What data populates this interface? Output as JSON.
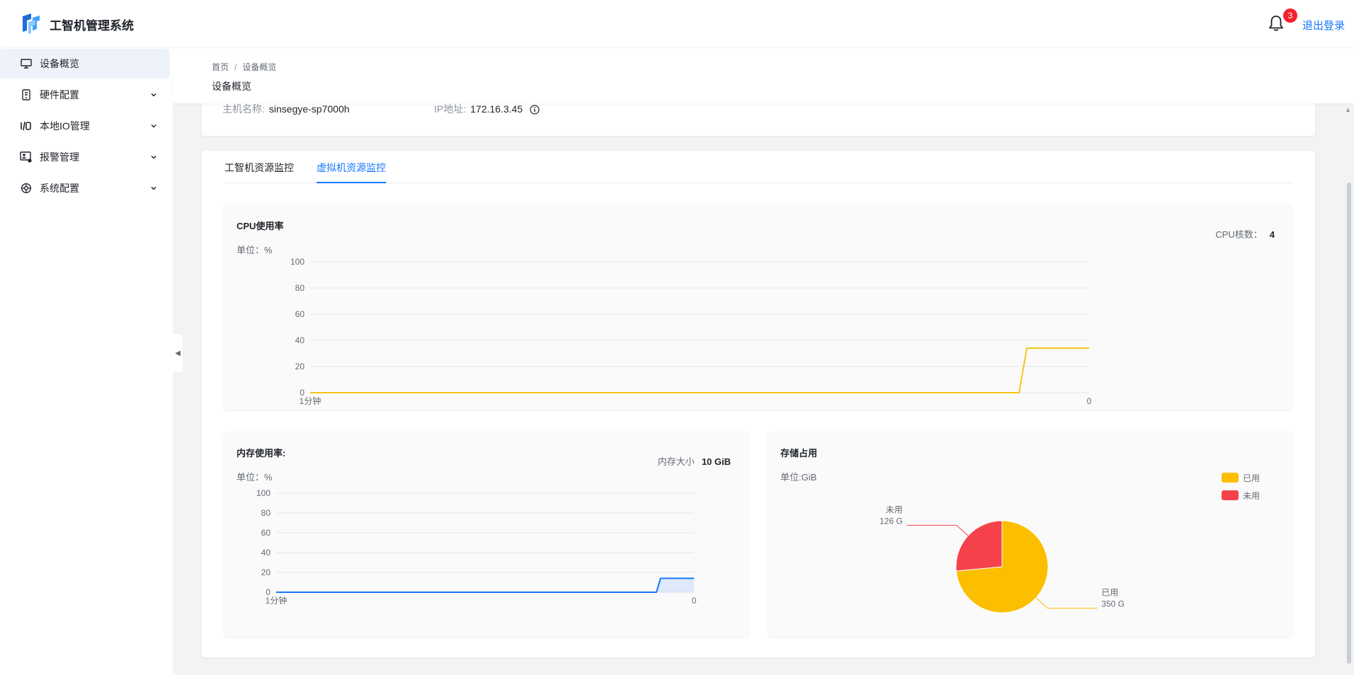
{
  "app": {
    "title": "工智机管理系统"
  },
  "header": {
    "notification_count": "3",
    "logout_label": "退出登录"
  },
  "sidebar": {
    "items": [
      {
        "label": "设备概览",
        "icon": "monitor-icon",
        "active": true,
        "expandable": false
      },
      {
        "label": "硬件配置",
        "icon": "hardware-icon",
        "active": false,
        "expandable": true
      },
      {
        "label": "本地IO管理",
        "icon": "io-icon",
        "active": false,
        "expandable": true
      },
      {
        "label": "报警管理",
        "icon": "alarm-icon",
        "active": false,
        "expandable": true
      },
      {
        "label": "系统配置",
        "icon": "settings-icon",
        "active": false,
        "expandable": true
      }
    ]
  },
  "breadcrumb": {
    "home": "首页",
    "separator": "/",
    "current": "设备概览"
  },
  "page": {
    "title": "设备概览"
  },
  "host_info": {
    "hostname_label": "主机名称:",
    "hostname_value": "sinsegye-sp7000h",
    "ip_label": "IP地址:",
    "ip_value": "172.16.3.45"
  },
  "tabs": [
    {
      "label": "工智机资源监控",
      "active": false
    },
    {
      "label": "虚拟机资源监控",
      "active": true
    }
  ],
  "cpu_panel": {
    "title": "CPU使用率",
    "unit": "单位：%",
    "cores_label": "CPU核数：",
    "cores_value": "4"
  },
  "memory_panel": {
    "title": "内存使用率:",
    "unit": "单位：%",
    "size_label": "内存大小",
    "size_value": "10 GiB"
  },
  "storage_panel": {
    "title": "存储占用",
    "unit": "单位:GiB"
  },
  "colors": {
    "accent": "#1677ff",
    "cpu_line": "#f5c518",
    "memory_line": "#1677ff",
    "used": "#fbbf00",
    "unused": "#f5424a",
    "badge": "#f5222d"
  },
  "chart_data": [
    {
      "type": "line",
      "name": "cpu",
      "x_labels": [
        "1分钟",
        "0"
      ],
      "yticks": [
        0,
        20,
        40,
        60,
        80,
        100
      ],
      "ylim": [
        0,
        100
      ],
      "ytick_labels": [
        "0",
        "20",
        "40",
        "60",
        "80",
        "100"
      ],
      "series": [
        {
          "values": [
            0,
            0,
            0,
            0,
            0,
            0,
            0,
            0,
            0,
            0,
            0,
            0,
            0,
            0,
            0,
            0,
            0,
            0,
            0,
            0,
            0,
            0,
            0,
            0,
            0,
            0,
            0,
            0,
            0,
            0,
            0,
            0,
            0,
            0,
            0,
            0,
            0,
            0,
            0,
            0,
            0,
            0,
            0,
            0,
            0,
            0,
            0,
            0,
            0,
            0,
            0,
            0,
            0,
            0,
            0,
            0,
            0,
            0,
            0,
            0,
            0,
            0,
            0,
            0,
            0,
            0,
            0,
            0,
            0,
            0,
            0,
            0,
            0,
            0,
            0,
            0,
            0,
            0,
            0,
            0,
            0,
            0,
            0,
            0,
            0,
            0,
            0,
            0,
            0,
            0,
            0,
            0,
            34,
            34,
            34,
            34,
            34,
            34,
            34,
            34,
            34
          ]
        }
      ]
    },
    {
      "type": "area",
      "name": "memory",
      "x_labels": [
        "1分钟",
        "0"
      ],
      "yticks": [
        0,
        20,
        40,
        60,
        80,
        100
      ],
      "ylim": [
        0,
        100
      ],
      "ytick_labels": [
        "0",
        "20",
        "40",
        "60",
        "80",
        "100"
      ],
      "series": [
        {
          "values": [
            0,
            0,
            0,
            0,
            0,
            0,
            0,
            0,
            0,
            0,
            0,
            0,
            0,
            0,
            0,
            0,
            0,
            0,
            0,
            0,
            0,
            0,
            0,
            0,
            0,
            0,
            0,
            0,
            0,
            0,
            0,
            0,
            0,
            0,
            0,
            0,
            0,
            0,
            0,
            0,
            0,
            0,
            0,
            0,
            0,
            0,
            0,
            0,
            0,
            0,
            0,
            0,
            0,
            0,
            0,
            0,
            0,
            0,
            0,
            0,
            0,
            0,
            0,
            0,
            0,
            0,
            0,
            0,
            0,
            0,
            0,
            0,
            0,
            0,
            0,
            0,
            0,
            0,
            0,
            0,
            0,
            0,
            0,
            0,
            0,
            0,
            0,
            0,
            0,
            0,
            0,
            0,
            14,
            14,
            14,
            14,
            14,
            14,
            14,
            14,
            14
          ]
        }
      ]
    },
    {
      "type": "pie",
      "name": "storage",
      "slices": [
        {
          "label": "已用",
          "value": 350,
          "value_label": "350 G"
        },
        {
          "label": "未用",
          "value": 126,
          "value_label": "126 G"
        }
      ],
      "legend": [
        "已用",
        "未用"
      ],
      "legend_position": "top-right"
    }
  ]
}
